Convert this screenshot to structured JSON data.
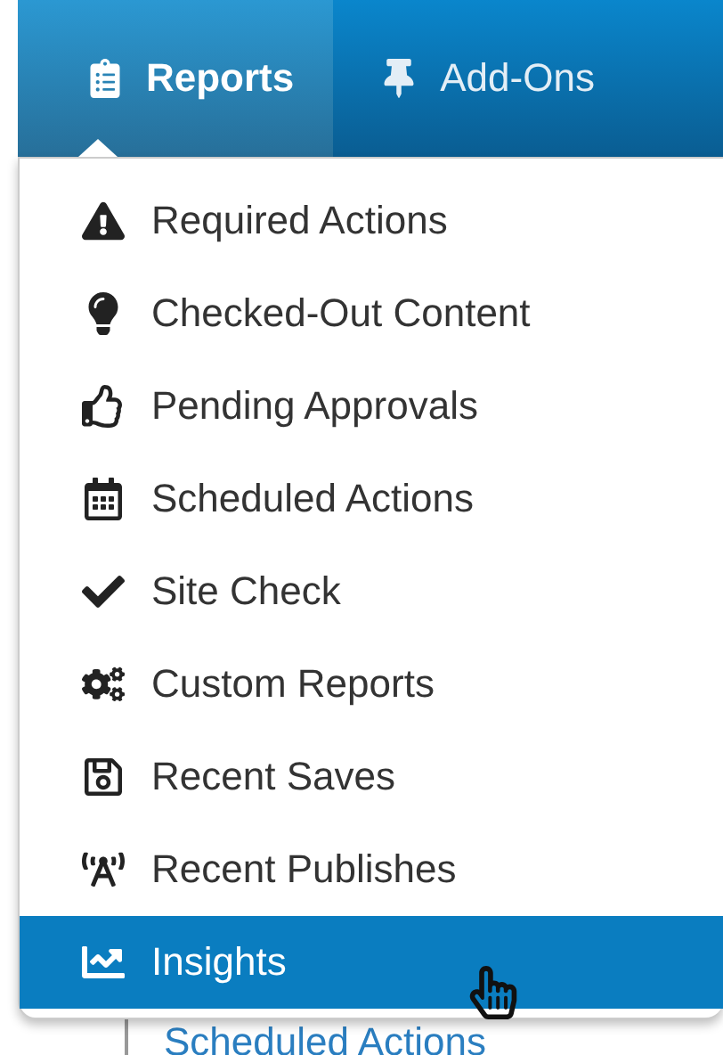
{
  "nav": {
    "tabs": [
      {
        "label": "Reports",
        "selected": true
      },
      {
        "label": "Add-Ons",
        "selected": false
      }
    ]
  },
  "menu": {
    "items": [
      {
        "label": "Required Actions",
        "selected": false
      },
      {
        "label": "Checked-Out Content",
        "selected": false
      },
      {
        "label": "Pending Approvals",
        "selected": false
      },
      {
        "label": "Scheduled Actions",
        "selected": false
      },
      {
        "label": "Site Check",
        "selected": false
      },
      {
        "label": "Custom Reports",
        "selected": false
      },
      {
        "label": "Recent Saves",
        "selected": false
      },
      {
        "label": "Recent Publishes",
        "selected": false
      },
      {
        "label": "Insights",
        "selected": true
      }
    ]
  },
  "background_link": "Scheduled Actions"
}
